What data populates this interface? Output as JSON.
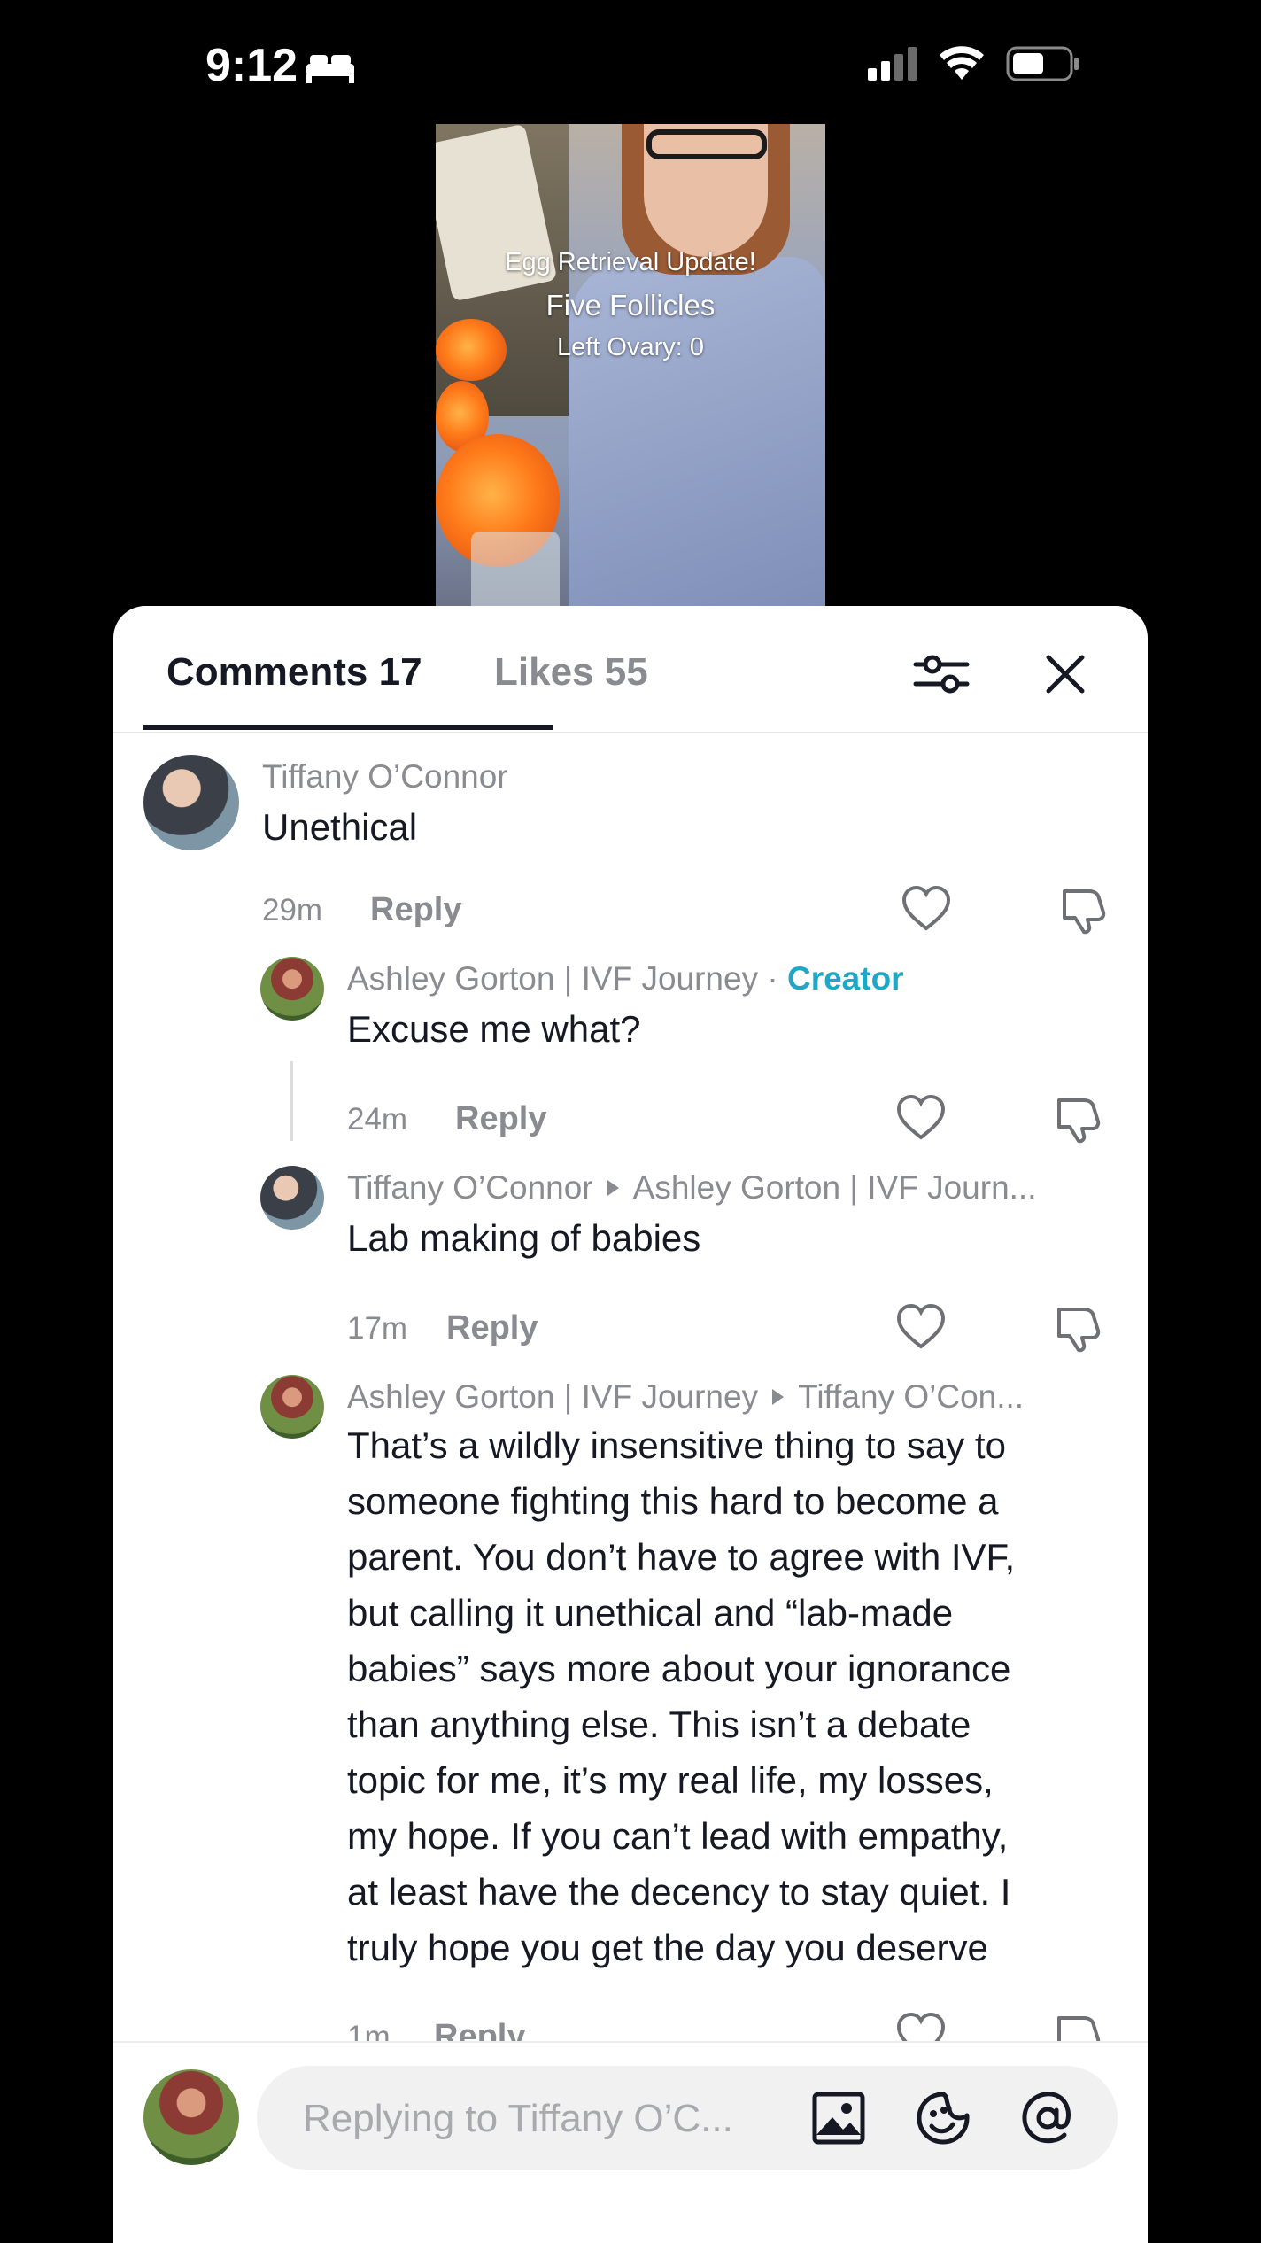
{
  "status_bar": {
    "time": "9:12"
  },
  "video": {
    "overlay_line1": "Egg Retrieval Update!",
    "overlay_line2": "Five Follicles",
    "overlay_line3": "Left Ovary: 0"
  },
  "tabs": [
    {
      "label": "Comments 17",
      "active": true
    },
    {
      "label": "Likes 55",
      "active": false
    }
  ],
  "comments": [
    {
      "author": "Tiffany O’Connor",
      "text": "Unethical",
      "time": "29m",
      "reply_label": "Reply"
    },
    {
      "author": "Ashley Gorton | IVF Journey",
      "separator": " · ",
      "badge": "Creator",
      "text": "Excuse me what?",
      "time": "24m",
      "reply_label": "Reply"
    },
    {
      "author": "Tiffany O’Connor",
      "reply_to": "Ashley Gorton | IVF Journ...",
      "text": "Lab making of babies",
      "time": "17m",
      "reply_label": "Reply"
    },
    {
      "author": "Ashley Gorton | IVF Journey",
      "reply_to": "Tiffany O’Con...",
      "lines": [
        "That’s a wildly insensitive thing to say to",
        "someone fighting this hard to become a",
        "parent. You don’t have to agree with IVF,",
        "but calling it unethical and “lab-made",
        "babies” says more about your ignorance",
        "than anything else. This isn’t a debate",
        "topic for me, it’s my real life, my losses,",
        "my hope. If you can’t lead with empathy,",
        "at least have the decency to stay quiet. I",
        "truly hope you get the day you deserve"
      ],
      "time": "1m",
      "reply_label": "Reply"
    }
  ],
  "input": {
    "placeholder": "Replying to Tiffany O’C..."
  },
  "icons": [
    "bed-icon",
    "signal-icon",
    "wifi-icon",
    "battery-icon",
    "filter-icon",
    "close-icon",
    "heart-icon",
    "dislike-icon",
    "image-icon",
    "emoji-icon",
    "mention-icon"
  ]
}
